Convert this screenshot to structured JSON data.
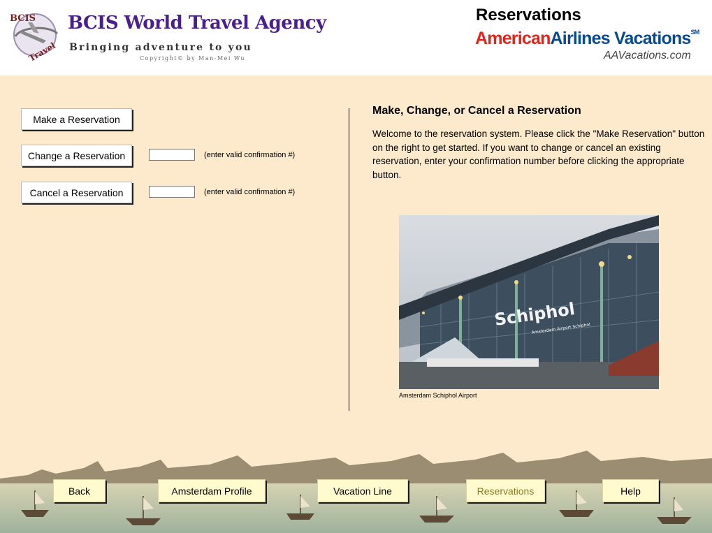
{
  "header": {
    "agency_name": "BCIS World Travel Agency",
    "tagline": "Bringing adventure to you",
    "copyright": "Copyright© by Man-Mei Wu",
    "emblem_text_top": "BCIS",
    "emblem_text_bottom": "Travel",
    "page_title": "Reservations",
    "aa_logo_part1": "American",
    "aa_logo_part2": "Airlines Vacations",
    "aa_logo_tm": "SM",
    "aa_url": "AAVacations.com"
  },
  "actions": {
    "make_label": "Make a Reservation",
    "change_label": "Change a Reservation",
    "cancel_label": "Cancel a Reservation",
    "change_hint": "(enter valid confirmation #)",
    "cancel_hint": "(enter valid confirmation #)",
    "change_value": "",
    "cancel_value": ""
  },
  "info": {
    "title": "Make, Change, or Cancel a Reservation",
    "body": "Welcome to the reservation system.  Please click the \"Make Reservation\" button on the right to get started.  If you want to change or cancel an existing reservation, enter your confirmation number before clicking the appropriate button.",
    "photo_sign": "Schiphol",
    "photo_subsign": "Amsterdam Airport Schiphol",
    "photo_caption": "Amsterdam Schiphol Airport"
  },
  "nav": {
    "back": "Back",
    "profile": "Amsterdam Profile",
    "vacation": "Vacation Line",
    "reservations": "Reservations",
    "help": "Help"
  },
  "colors": {
    "page_bg": "#fde9cb",
    "agency_purple": "#4a1f8c",
    "aa_red": "#e2231a",
    "aa_blue": "#0a4a8f",
    "nav_button_bg": "#fffbcf",
    "nav_active_text": "#8a7a20"
  }
}
